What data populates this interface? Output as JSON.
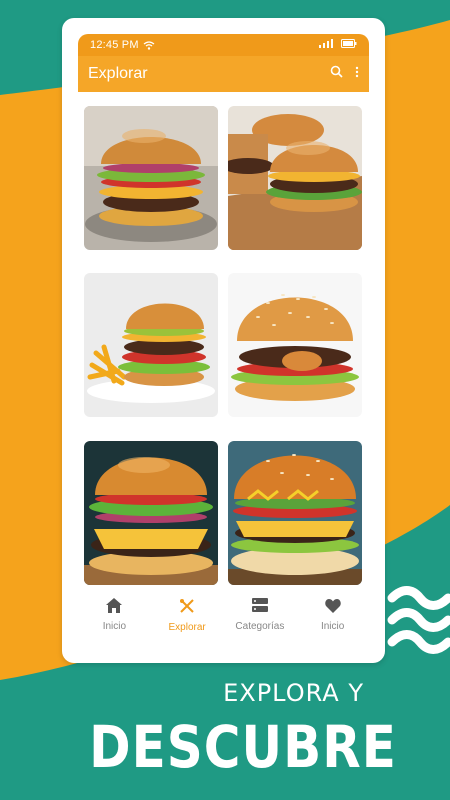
{
  "status": {
    "time": "12:45 PM"
  },
  "appbar": {
    "title": "Explorar"
  },
  "cards": [
    {
      "name": "burger-classic"
    },
    {
      "name": "burger-sliders"
    },
    {
      "name": "burger-fries"
    },
    {
      "name": "burger-sesame"
    },
    {
      "name": "burger-dark"
    },
    {
      "name": "burger-mustard"
    }
  ],
  "nav": [
    {
      "label": "Inicio",
      "icon": "home-icon"
    },
    {
      "label": "Explorar",
      "icon": "utensils-icon"
    },
    {
      "label": "Categorías",
      "icon": "categories-icon"
    },
    {
      "label": "Inicio",
      "icon": "heart-icon"
    }
  ],
  "promo": {
    "line1": "EXPLORA Y",
    "line2": "DESCUBRE"
  },
  "colors": {
    "orange": "#f5a31c",
    "teal": "#1f9a84",
    "accent": "#f09a1a"
  }
}
